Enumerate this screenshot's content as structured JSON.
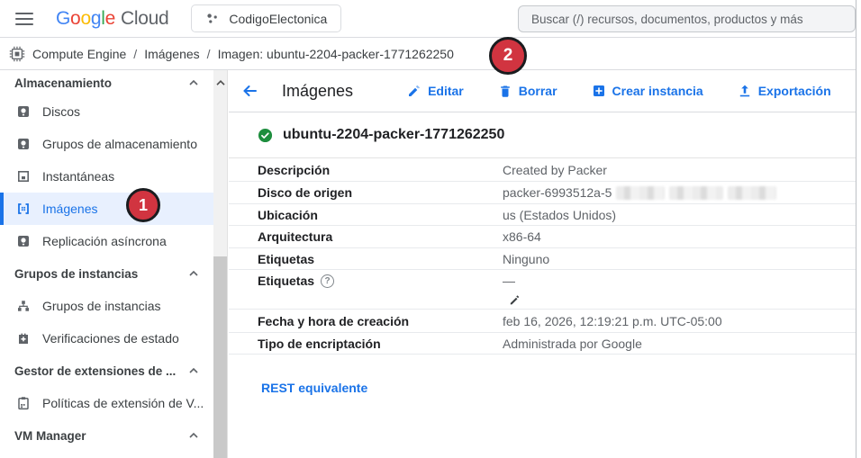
{
  "colors": {
    "accent_blue": "#1a73e8",
    "selected_bg": "#e8f0fe",
    "status_green": "#1e8e3e",
    "annotation_red": "#d13440",
    "text_dark": "#202124",
    "text_gray": "#5f6368",
    "border": "#dadce0",
    "google_blue": "#4285F4",
    "google_red": "#EA4335",
    "google_yellow": "#FBBC04",
    "google_green": "#34A853"
  },
  "topbar": {
    "logo": {
      "letters": [
        "G",
        "o",
        "o",
        "g",
        "l",
        "e"
      ],
      "cloud": "Cloud"
    },
    "project": {
      "name": "CodigoElectonica"
    },
    "search": {
      "placeholder": "Buscar (/) recursos, documentos, productos y más"
    }
  },
  "breadcrumb": {
    "separator": "/",
    "items": [
      "Compute Engine",
      "Imágenes",
      "Imagen: ubuntu-2204-packer-1771262250"
    ]
  },
  "annotations": {
    "badge1": "1",
    "badge2": "2"
  },
  "sidebar": {
    "rows": [
      {
        "type": "header",
        "label": "Almacenamiento"
      },
      {
        "type": "item",
        "icon": "disk-icon",
        "label": "Discos"
      },
      {
        "type": "item",
        "icon": "disk-icon",
        "label": "Grupos de almacenamiento"
      },
      {
        "type": "item",
        "icon": "snapshot-icon",
        "label": "Instantáneas"
      },
      {
        "type": "item",
        "icon": "images-icon",
        "label": "Imágenes",
        "selected": true
      },
      {
        "type": "item",
        "icon": "disk-icon",
        "label": "Replicación asíncrona"
      },
      {
        "type": "header",
        "label": "Grupos de instancias"
      },
      {
        "type": "item",
        "icon": "instance-groups-icon",
        "label": "Grupos de instancias"
      },
      {
        "type": "item",
        "icon": "health-check-icon",
        "label": "Verificaciones de estado"
      },
      {
        "type": "header",
        "label": "Gestor de extensiones de ..."
      },
      {
        "type": "item",
        "icon": "policy-icon",
        "label": "Políticas de extensión de V..."
      },
      {
        "type": "header",
        "label": "VM Manager"
      }
    ]
  },
  "main": {
    "header": {
      "title": "Imágenes",
      "actions": [
        {
          "icon": "pencil-icon",
          "label": "Editar"
        },
        {
          "icon": "trash-icon",
          "label": "Borrar"
        },
        {
          "icon": "create-instance-icon",
          "label": "Crear instancia"
        },
        {
          "icon": "export-icon",
          "label": "Exportación"
        }
      ]
    },
    "image": {
      "status_icon": "check-circle-icon",
      "name": "ubuntu-2204-packer-1771262250"
    },
    "details": {
      "help_glyph": "?",
      "rows": [
        {
          "label": "Descripción",
          "value": "Created by Packer"
        },
        {
          "label": "Disco de origen",
          "value": "packer-6993512a-5",
          "redacted": true
        },
        {
          "label": "Ubicación",
          "value": "us (Estados Unidos)"
        },
        {
          "label": "Arquitectura",
          "value": "x86-64"
        },
        {
          "label": "Etiquetas",
          "value": "Ninguno"
        },
        {
          "label": "Etiquetas",
          "value": "—",
          "has_help": true
        },
        {
          "label": "Fecha y hora de creación",
          "value": "feb 16, 2026, 12:19:21 p.m. UTC-05:00"
        },
        {
          "label": "Tipo de encriptación",
          "value": "Administrada por Google"
        }
      ]
    },
    "rest_link": "REST equivalente"
  }
}
